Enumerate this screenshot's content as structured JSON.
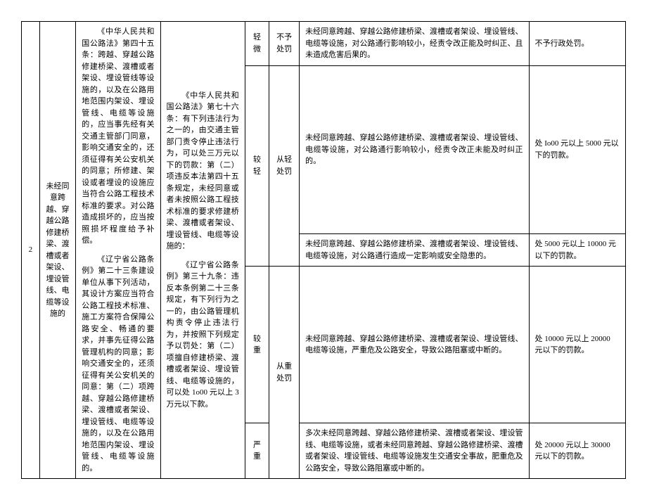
{
  "row": {
    "number": "2",
    "title": "未经同意跨越、穿越公路修建桥梁、渡槽或者架设、埋设管线、电缆等设施的",
    "basis_1": "《中华人民共和国公路法》第四十五条：跨越、穿越公路修建桥梁、渡槽或者架设、埋设管线等设施的，以及在公路用地范围内架设、埋设管线、电缆等设施的，应当事先经有关交通主管部门同意，影响交通安全的，还须征得有关公安机关的同意；所修建、架设或者埋设的设施应当符合公路工程技术标准的要求。对公路造成损坏的，应当按照损坏程度给予补偿。",
    "basis_2": "《辽宁省公路条例》第二十三条建设单位从事下列活动，其设计方案应当符合公路工程技术标准、施工方案符合保障公路安全、畅通的要求，并事先征得公路管理机构的同意；影响交通安全的，还须征得有关公安机关的同意：第（二）项跨越、穿越公路修建桥梁、渡槽或者架设、埋设管线、电缆等设施的，以及在公路用地范围内架设、埋设管线、电缆等设施的。",
    "law_1": "《中华人民共和国公路法》第七十六条：有下列违法行为之一的，由交通主管部门责令停止违法行为，可以处三万元以下的罚款：第（二）项违反本法第四十五条规定，未经同意或者未按照公路工程技术标准的要求修建桥梁、渡槽或者架设、埋设管线、电缆等设施的：",
    "law_2": "《辽宁省公路条例》第三十九条：违反本条例第二十三条规定，有下列行为之一的，由公路管理机构责令停止违法行为，并按照下列规定予以罚处：第（二）项擅自修建桥梁、渡槽或者架设、埋设管线、电缆等设施的，可以处 1o00 元以上 3 万元以下款。",
    "levels": {
      "l1": {
        "name": "轻微",
        "dir": "不予处罚",
        "desc": "未经同意跨越、穿越公路修建桥梁、渡槽或者架设、埋设管线、电缆等设施，对公路通行影响较小，经责令改正能及时纠正、且未造成危害后果的。",
        "penalty": "不予行政处罚。"
      },
      "l2": {
        "name": "较轻",
        "dir": "从轻处罚",
        "desc": "未经同意跨越、穿越公路修建桥梁、渡槽或者架设、埋设管线、电缆等设施，对公路通行影响较小，经责令改正未能及时纠正的。",
        "penalty": "处 Io00 元以上 5000 元以下的罚款。"
      },
      "l3": {
        "desc": "未经同意跨越、穿越公路修建桥梁、渡槽或者架设、埋设管线、电缆等设施，对公路通行造成一定影响或安全隐患的。",
        "penalty": "处 5000 元以上 10000 元以下的罚款。"
      },
      "l4": {
        "name": "较重",
        "dir": "从重处罚",
        "desc": "未经同意跨越、穿越公路修建桥梁、渡槽或者架设、埋设管线、电缆等设施，严重危及公路安全，导致公路阻塞或中断的。",
        "penalty": "处 10000 元以上 20000 元以下的罚款。"
      },
      "l5": {
        "name": "严重",
        "desc": "多次未经同意跨越、穿越公路修建桥梁、渡槽或者架设、埋设管线、电缆等设施，或者未经同意跨越、穿越公路修建桥梁、渡槽或者架设、埋设管线、电缆等设施发生交通安全事故，肥重危及公路安全，导致公路阻塞或中断的。",
        "penalty": "处 20000 元以上 30000 元以下的罚款。"
      }
    }
  }
}
